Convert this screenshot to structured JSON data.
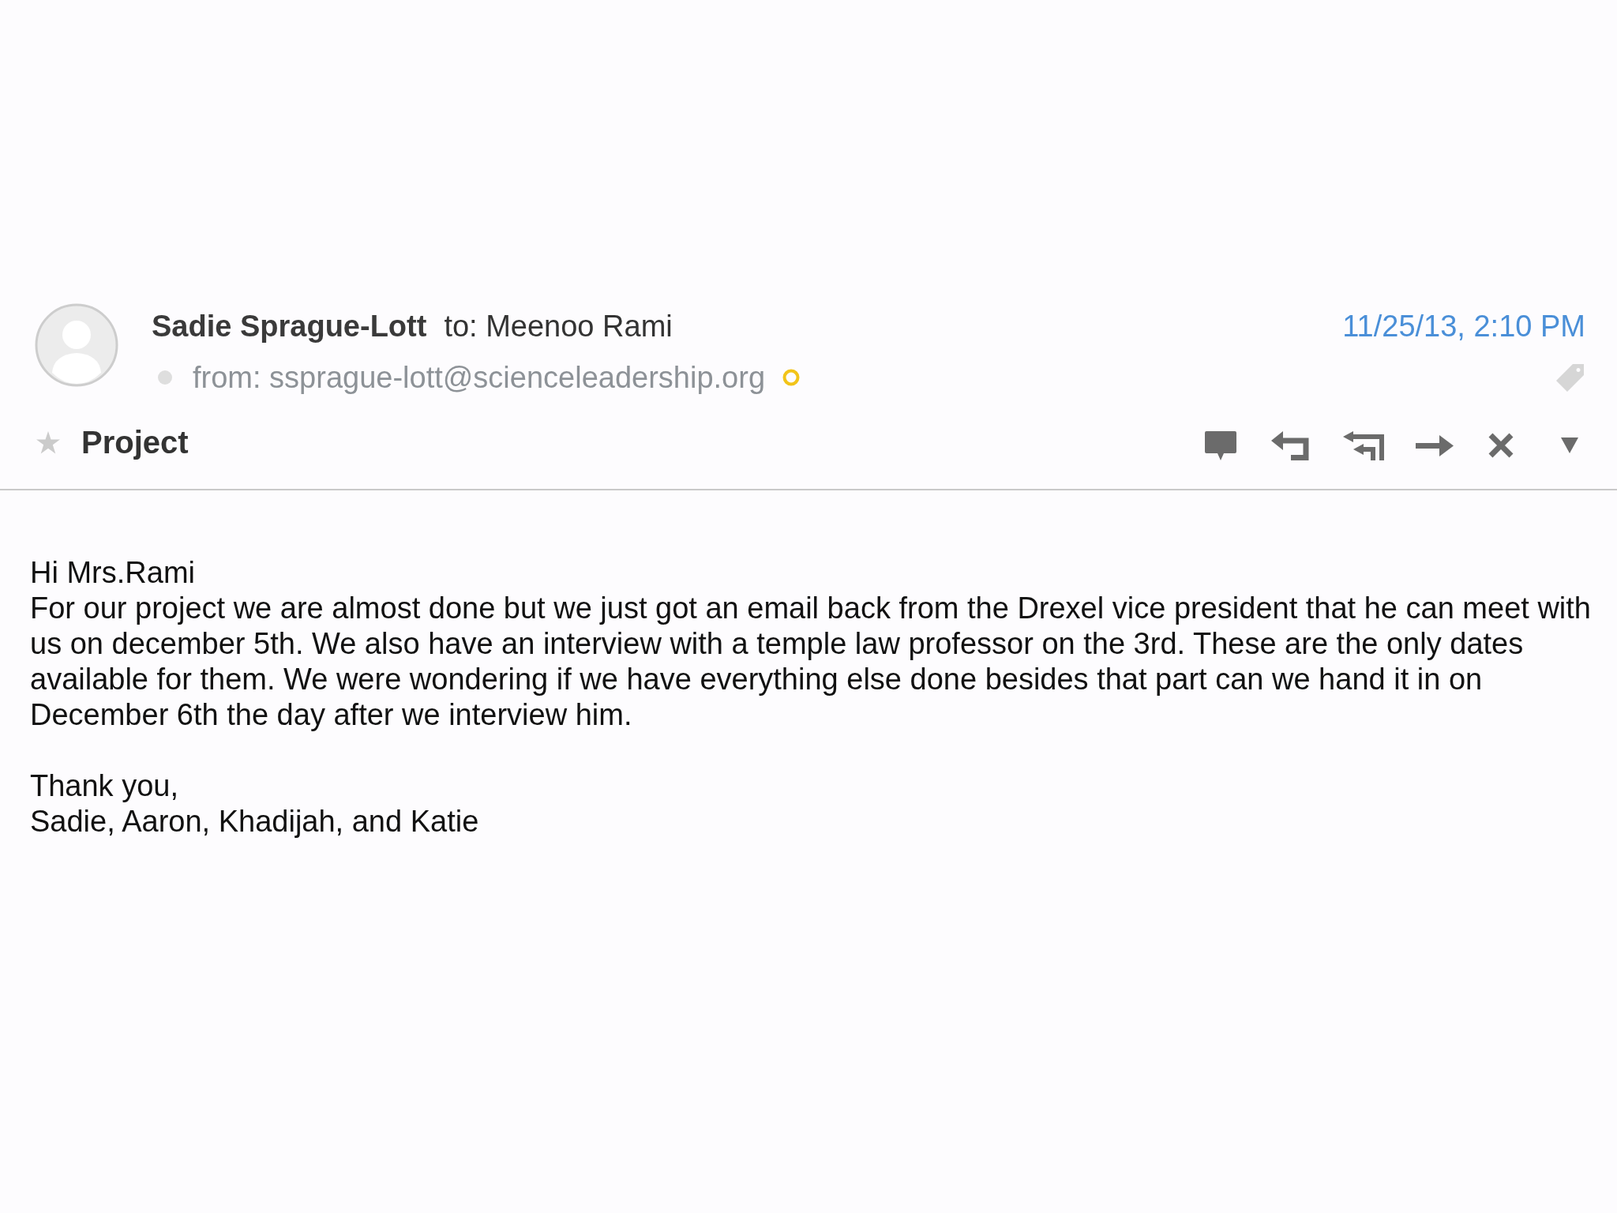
{
  "message": {
    "sender": {
      "name": "Sadie Sprague-Lott",
      "online": false
    },
    "recipient": "to: Meenoo Rami",
    "from": "from: ssprague-lott@scienceleadership.org",
    "date": "11/25/13, 2:10 PM",
    "starred": false,
    "subject": "Project"
  },
  "body": {
    "greeting": "Hi Mrs.Rami",
    "paragraph_lines": [
      "For our project we are almost done but we just got an email back from the Drexel vice president that he can meet with",
      "us on december 5th. We also have an interview with a temple law professor on the 3rd. These are the only dates",
      "available for them. We were wondering if we have everything else done besides that part can we hand it in on",
      "December 6th the day after we interview him."
    ],
    "closing": "Thank you,",
    "signature": "Sadie, Aaron, Khadijah, and Katie"
  }
}
